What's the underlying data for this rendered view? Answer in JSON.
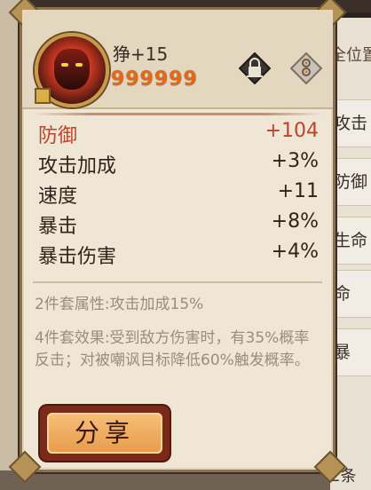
{
  "background": {
    "top_partial": "",
    "header_partial": "全位置",
    "rows": [
      "攻击",
      "防御",
      "生命",
      "命",
      "暴"
    ],
    "bottom_partial": "2条"
  },
  "equipment": {
    "name": "狰+15",
    "stars": [
      "9",
      "9",
      "9",
      "9",
      "9",
      "9"
    ],
    "portrait": "fire-spirit-portrait"
  },
  "icons": {
    "lock": "lock-icon",
    "key": "keyhole-icon"
  },
  "stats": {
    "main": {
      "label": "防御",
      "value": "+104"
    },
    "sub": [
      {
        "label": "攻击加成",
        "value": "+3%"
      },
      {
        "label": "速度",
        "value": "+11"
      },
      {
        "label": "暴击",
        "value": "+8%"
      },
      {
        "label": "暴击伤害",
        "value": "+4%"
      }
    ]
  },
  "set_bonus": {
    "two_piece": "2件套属性:攻击加成15%",
    "four_piece": "4件套效果:受到敌方伤害时，有35%概率反击；对被嘲讽目标降低60%触发概率。"
  },
  "share_label": "分享",
  "colors": {
    "main_stat": "#c0422a",
    "stars": "#e06a1c",
    "set_text": "#9a8d7e",
    "card_bg": "#efe6d5"
  }
}
